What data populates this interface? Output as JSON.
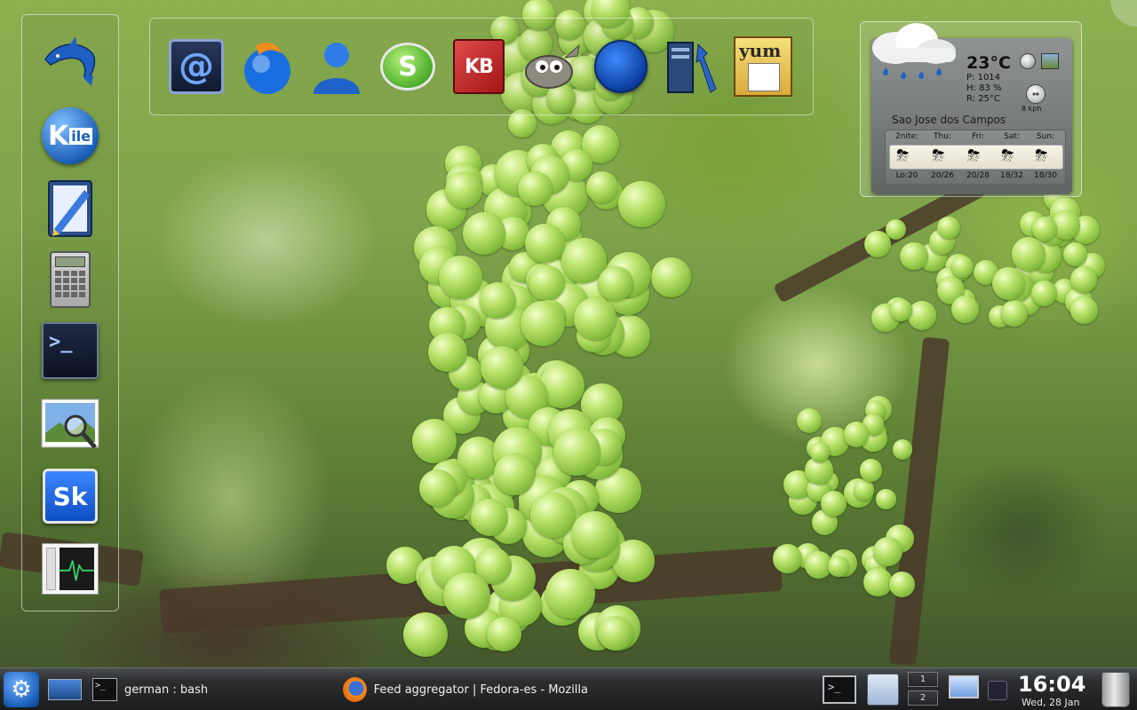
{
  "left_panel": {
    "launchers": [
      {
        "name": "dolphin-launcher",
        "icon": "dolphin-icon"
      },
      {
        "name": "kile-launcher",
        "icon": "kile-icon",
        "glyph": "K"
      },
      {
        "name": "text-editor-launcher",
        "icon": "text-editor-icon"
      },
      {
        "name": "calculator-launcher",
        "icon": "calculator-icon"
      },
      {
        "name": "terminal-launcher",
        "icon": "terminal-icon",
        "glyph": ">_"
      },
      {
        "name": "image-viewer-launcher",
        "icon": "image-viewer-icon"
      },
      {
        "name": "skype-launcher",
        "icon": "skype-icon",
        "glyph": "Sk"
      },
      {
        "name": "system-monitor-launcher",
        "icon": "system-monitor-icon"
      }
    ]
  },
  "top_panel": {
    "launchers": [
      {
        "name": "email-launcher",
        "icon": "email-icon",
        "glyph": "@"
      },
      {
        "name": "thunderbird-launcher",
        "icon": "thunderbird-icon"
      },
      {
        "name": "messenger-launcher",
        "icon": "messenger-icon"
      },
      {
        "name": "skype-chat-launcher",
        "icon": "skype-chat-icon",
        "glyph": "S"
      },
      {
        "name": "kbibtex-launcher",
        "icon": "kbibtex-icon",
        "glyph": "KB"
      },
      {
        "name": "gimp-launcher",
        "icon": "gimp-icon"
      },
      {
        "name": "wolf-launcher",
        "icon": "wolf-icon"
      },
      {
        "name": "system-settings-launcher",
        "icon": "system-settings-icon"
      },
      {
        "name": "yum-launcher",
        "icon": "yum-icon",
        "glyph": "yum"
      }
    ]
  },
  "weather": {
    "temperature": "23°C",
    "pressure": "P: 1014",
    "humidity": "H: 83 %",
    "realfeel": "R: 25°C",
    "wind": "8 kph",
    "city": "Sao Jose dos Campos",
    "forecast": [
      {
        "day": "2nite:",
        "temp": "Lo:20"
      },
      {
        "day": "Thu:",
        "temp": "20/26"
      },
      {
        "day": "Fri:",
        "temp": "20/28"
      },
      {
        "day": "Sat:",
        "temp": "18/32"
      },
      {
        "day": "Sun:",
        "temp": "18/30"
      }
    ]
  },
  "taskbar": {
    "tasks": [
      {
        "label": "german : bash",
        "icon": "terminal-icon"
      },
      {
        "label": "Feed aggregator | Fedora-es - Mozilla",
        "icon": "firefox-icon"
      }
    ],
    "pager": [
      "1",
      "2"
    ],
    "clock_time": "16:04",
    "clock_date": "Wed, 28 Jan"
  },
  "colors": {
    "taskbar_bg": "#1b1c1e",
    "panel_border": "#ffffff",
    "kde_blue": "#1c5fb8"
  }
}
